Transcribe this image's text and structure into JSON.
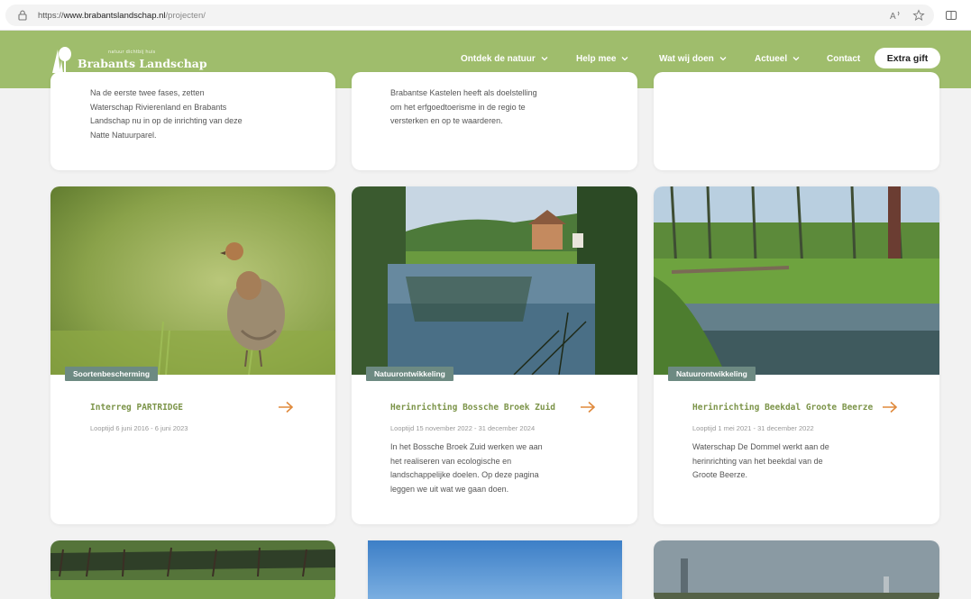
{
  "browser": {
    "url_scheme": "https://",
    "url_host": "www.brabantslandschap.nl",
    "url_path": "/projecten/"
  },
  "header": {
    "logo_subtitle": "natuur dichtbij huis",
    "logo_title": "Brabants Landschap",
    "nav": [
      {
        "label": "Ontdek de natuur"
      },
      {
        "label": "Help mee"
      },
      {
        "label": "Wat wij doen"
      },
      {
        "label": "Actueel"
      },
      {
        "label": "Contact"
      }
    ],
    "cta_label": "Extra gift"
  },
  "colors": {
    "header_bg": "#9fbd6c",
    "title_green": "#7c9449",
    "arrow_orange": "#e08a3c",
    "badge_bg": "#6d8a82"
  },
  "top_cards": [
    {
      "desc_lines": [
        "Na de eerste twee fases, zetten",
        "Waterschap Rivierenland en Brabants",
        "Landschap nu in op de inrichting van deze",
        "Natte Natuurparel."
      ]
    },
    {
      "desc_lines": [
        "Brabantse Kastelen heeft als doelstelling",
        "om het erfgoedtoerisme in de regio te",
        "versterken en op te waarderen."
      ]
    },
    {
      "desc_lines": []
    }
  ],
  "cards": [
    {
      "badge": "Soortenbescherming",
      "title": "Interreg PARTRIDGE",
      "date": "Looptijd 6 juni 2016 - 6 juni 2023",
      "desc_lines": []
    },
    {
      "badge": "Natuurontwikkeling",
      "title": "Herinrichting Bossche Broek Zuid",
      "date": "Looptijd 15 november 2022 - 31 december 2024",
      "desc_lines": [
        "In het Bossche Broek Zuid werken we aan",
        "het realiseren van ecologische en",
        "landschappelijke doelen. Op deze pagina",
        "leggen we uit wat we gaan doen."
      ]
    },
    {
      "badge": "Natuurontwikkeling",
      "title": "Herinrichting Beekdal Groote Beerze",
      "date": "Looptijd 1 mei 2021 - 31 december 2022",
      "desc_lines": [
        "Waterschap De Dommel werkt aan de",
        "herinrichting van het beekdal van de",
        "Groote Beerze."
      ]
    }
  ]
}
